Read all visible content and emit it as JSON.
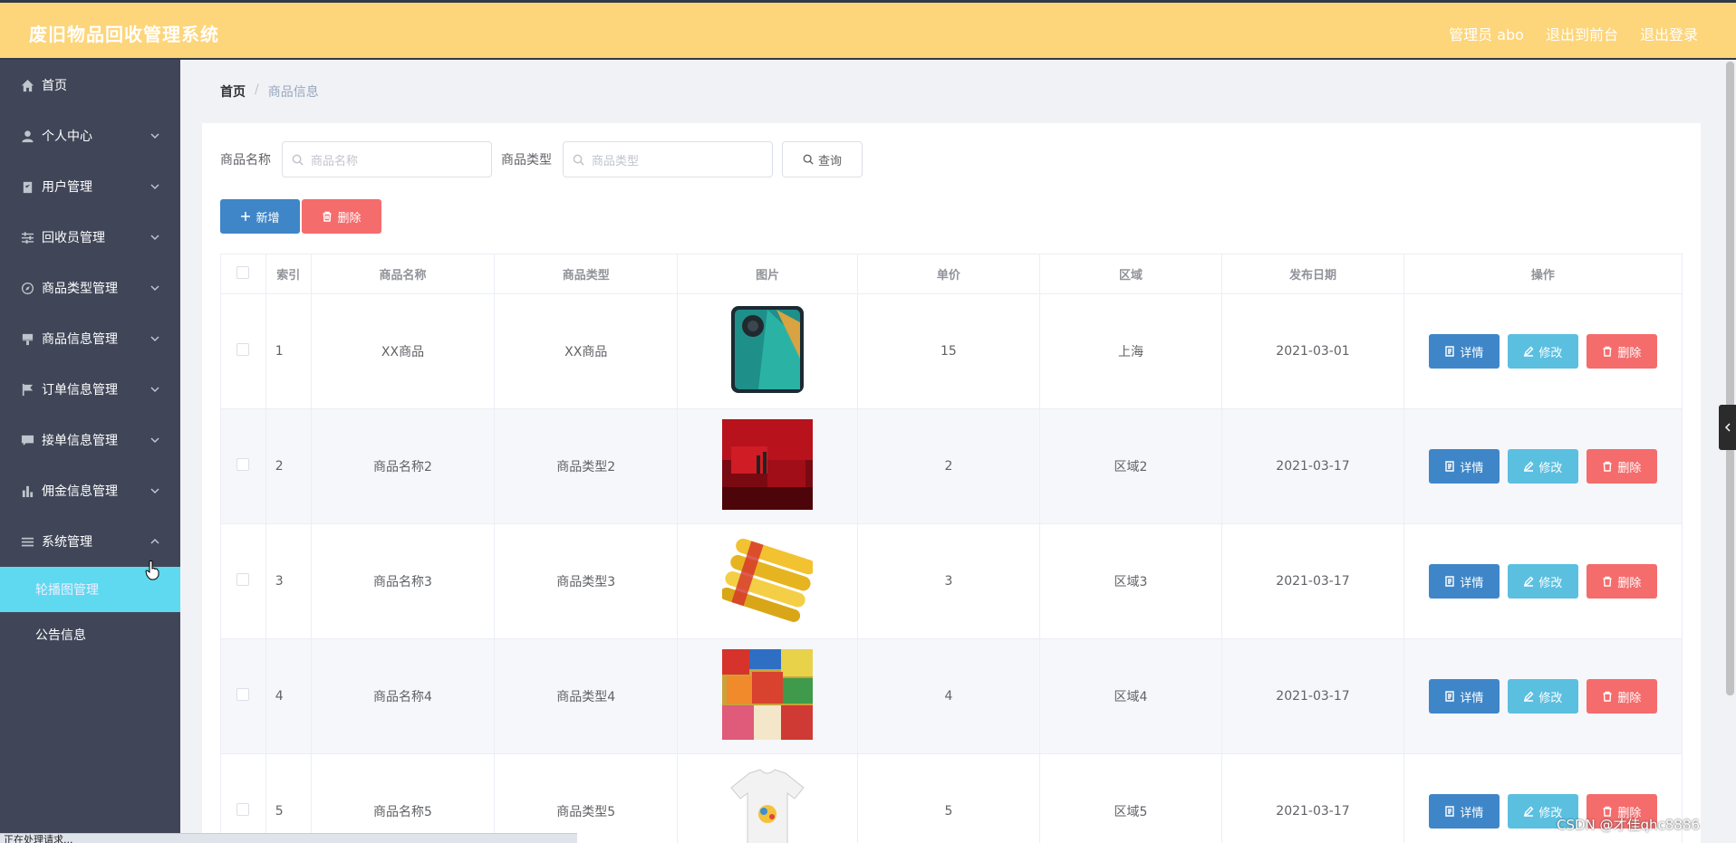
{
  "header": {
    "title": "废旧物品回收管理系统",
    "admin": "管理员 abo",
    "front": "退出到前台",
    "logout": "退出登录"
  },
  "sidebar": {
    "items": [
      {
        "label": "首页",
        "icon": "home-icon"
      },
      {
        "label": "个人中心",
        "icon": "user-icon"
      },
      {
        "label": "用户管理",
        "icon": "clipboard-icon"
      },
      {
        "label": "回收员管理",
        "icon": "sliders-icon"
      },
      {
        "label": "商品类型管理",
        "icon": "compass-icon"
      },
      {
        "label": "商品信息管理",
        "icon": "brush-icon"
      },
      {
        "label": "订单信息管理",
        "icon": "flag-icon"
      },
      {
        "label": "接单信息管理",
        "icon": "chat-icon"
      },
      {
        "label": "佣金信息管理",
        "icon": "bar-chart-icon"
      },
      {
        "label": "系统管理",
        "icon": "list-icon"
      }
    ],
    "sub_items": [
      "轮播图管理",
      "公告信息"
    ]
  },
  "breadcrumb": {
    "home": "首页",
    "sep": "/",
    "current": "商品信息"
  },
  "search": {
    "name_label": "商品名称",
    "name_placeholder": "商品名称",
    "type_label": "商品类型",
    "type_placeholder": "商品类型",
    "query_label": "查询"
  },
  "actions": {
    "add": "新增",
    "delete": "删除"
  },
  "table": {
    "columns": [
      "索引",
      "商品名称",
      "商品类型",
      "图片",
      "单价",
      "区域",
      "发布日期",
      "操作"
    ],
    "rows": [
      {
        "index": "1",
        "name": "XX商品",
        "type": "XX商品",
        "price": "15",
        "region": "上海",
        "date": "2021-03-01"
      },
      {
        "index": "2",
        "name": "商品名称2",
        "type": "商品类型2",
        "price": "2",
        "region": "区域2",
        "date": "2021-03-17"
      },
      {
        "index": "3",
        "name": "商品名称3",
        "type": "商品类型3",
        "price": "3",
        "region": "区域3",
        "date": "2021-03-17"
      },
      {
        "index": "4",
        "name": "商品名称4",
        "type": "商品类型4",
        "price": "4",
        "region": "区域4",
        "date": "2021-03-17"
      },
      {
        "index": "5",
        "name": "商品名称5",
        "type": "商品类型5",
        "price": "5",
        "region": "区域5",
        "date": "2021-03-17"
      }
    ],
    "op_detail": "详情",
    "op_edit": "修改",
    "op_delete": "删除"
  },
  "status": "正在处理请求...",
  "watermark": "CSDN @才佳qhc8886",
  "colors": {
    "header_bg": "#fdd57a",
    "sidebar_bg": "#404658",
    "active_sub": "#5fd9ef",
    "primary": "#3f86c8",
    "info": "#5bbfe0",
    "danger": "#f56c6c"
  }
}
